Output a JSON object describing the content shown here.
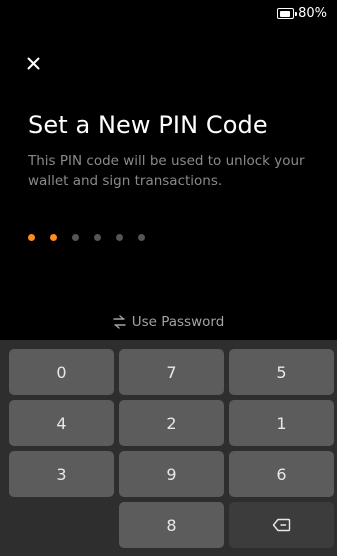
{
  "status_bar": {
    "battery_percent": "80%"
  },
  "header": {
    "close_icon": "close-icon",
    "title": "Set a New PIN Code",
    "subtitle": "This PIN code will be used to unlock your wallet and sign transactions."
  },
  "pin": {
    "length": 6,
    "entered": 2,
    "filled_color": "#ff8a1f",
    "empty_color": "#555555"
  },
  "use_password": {
    "icon": "swap-icon",
    "label": "Use Password"
  },
  "keypad": {
    "keys": [
      "0",
      "7",
      "5",
      "4",
      "2",
      "1",
      "3",
      "9",
      "6",
      "",
      "8",
      ""
    ],
    "backspace_icon": "backspace-icon"
  }
}
